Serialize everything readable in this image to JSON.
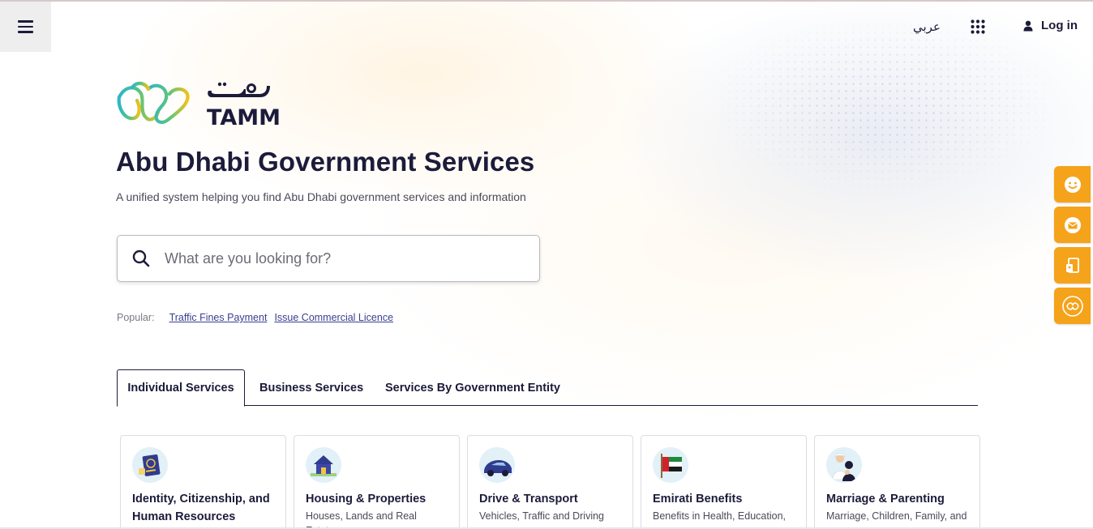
{
  "header": {
    "language_toggle": "عربي",
    "login_label": "Log in"
  },
  "brand": {
    "logo_arabic": "تم",
    "logo_text": "TAMM"
  },
  "hero": {
    "title": "Abu Dhabi Government Services",
    "subtitle": "A unified system helping you find Abu Dhabi government services and information"
  },
  "search": {
    "placeholder": "What are you looking for?"
  },
  "popular": {
    "label": "Popular:",
    "links": [
      "Traffic Fines Payment",
      "Issue Commercial Licence"
    ]
  },
  "tabs": [
    "Individual Services",
    "Business Services",
    "Services By Government Entity"
  ],
  "cards": [
    {
      "title": "Identity, Citizenship, and Human Resources",
      "desc": "",
      "icon": "passport-icon"
    },
    {
      "title": "Housing & Properties",
      "desc": "Houses, Lands and Real Estate",
      "icon": "house-icon"
    },
    {
      "title": "Drive & Transport",
      "desc": "Vehicles, Traffic and Driving",
      "icon": "car-icon"
    },
    {
      "title": "Emirati Benefits",
      "desc": "Benefits in Health, Education,",
      "icon": "uae-flag-icon"
    },
    {
      "title": "Marriage & Parenting",
      "desc": "Marriage, Children, Family, and",
      "icon": "family-icon"
    }
  ],
  "side_tools": [
    "feedback-smiley-icon",
    "mail-icon",
    "document-icon",
    "tamm-emblem-icon"
  ],
  "colors": {
    "primary_text": "#1c1b3a",
    "accent_orange": "#f5a31a",
    "link": "#3a3f8f"
  }
}
